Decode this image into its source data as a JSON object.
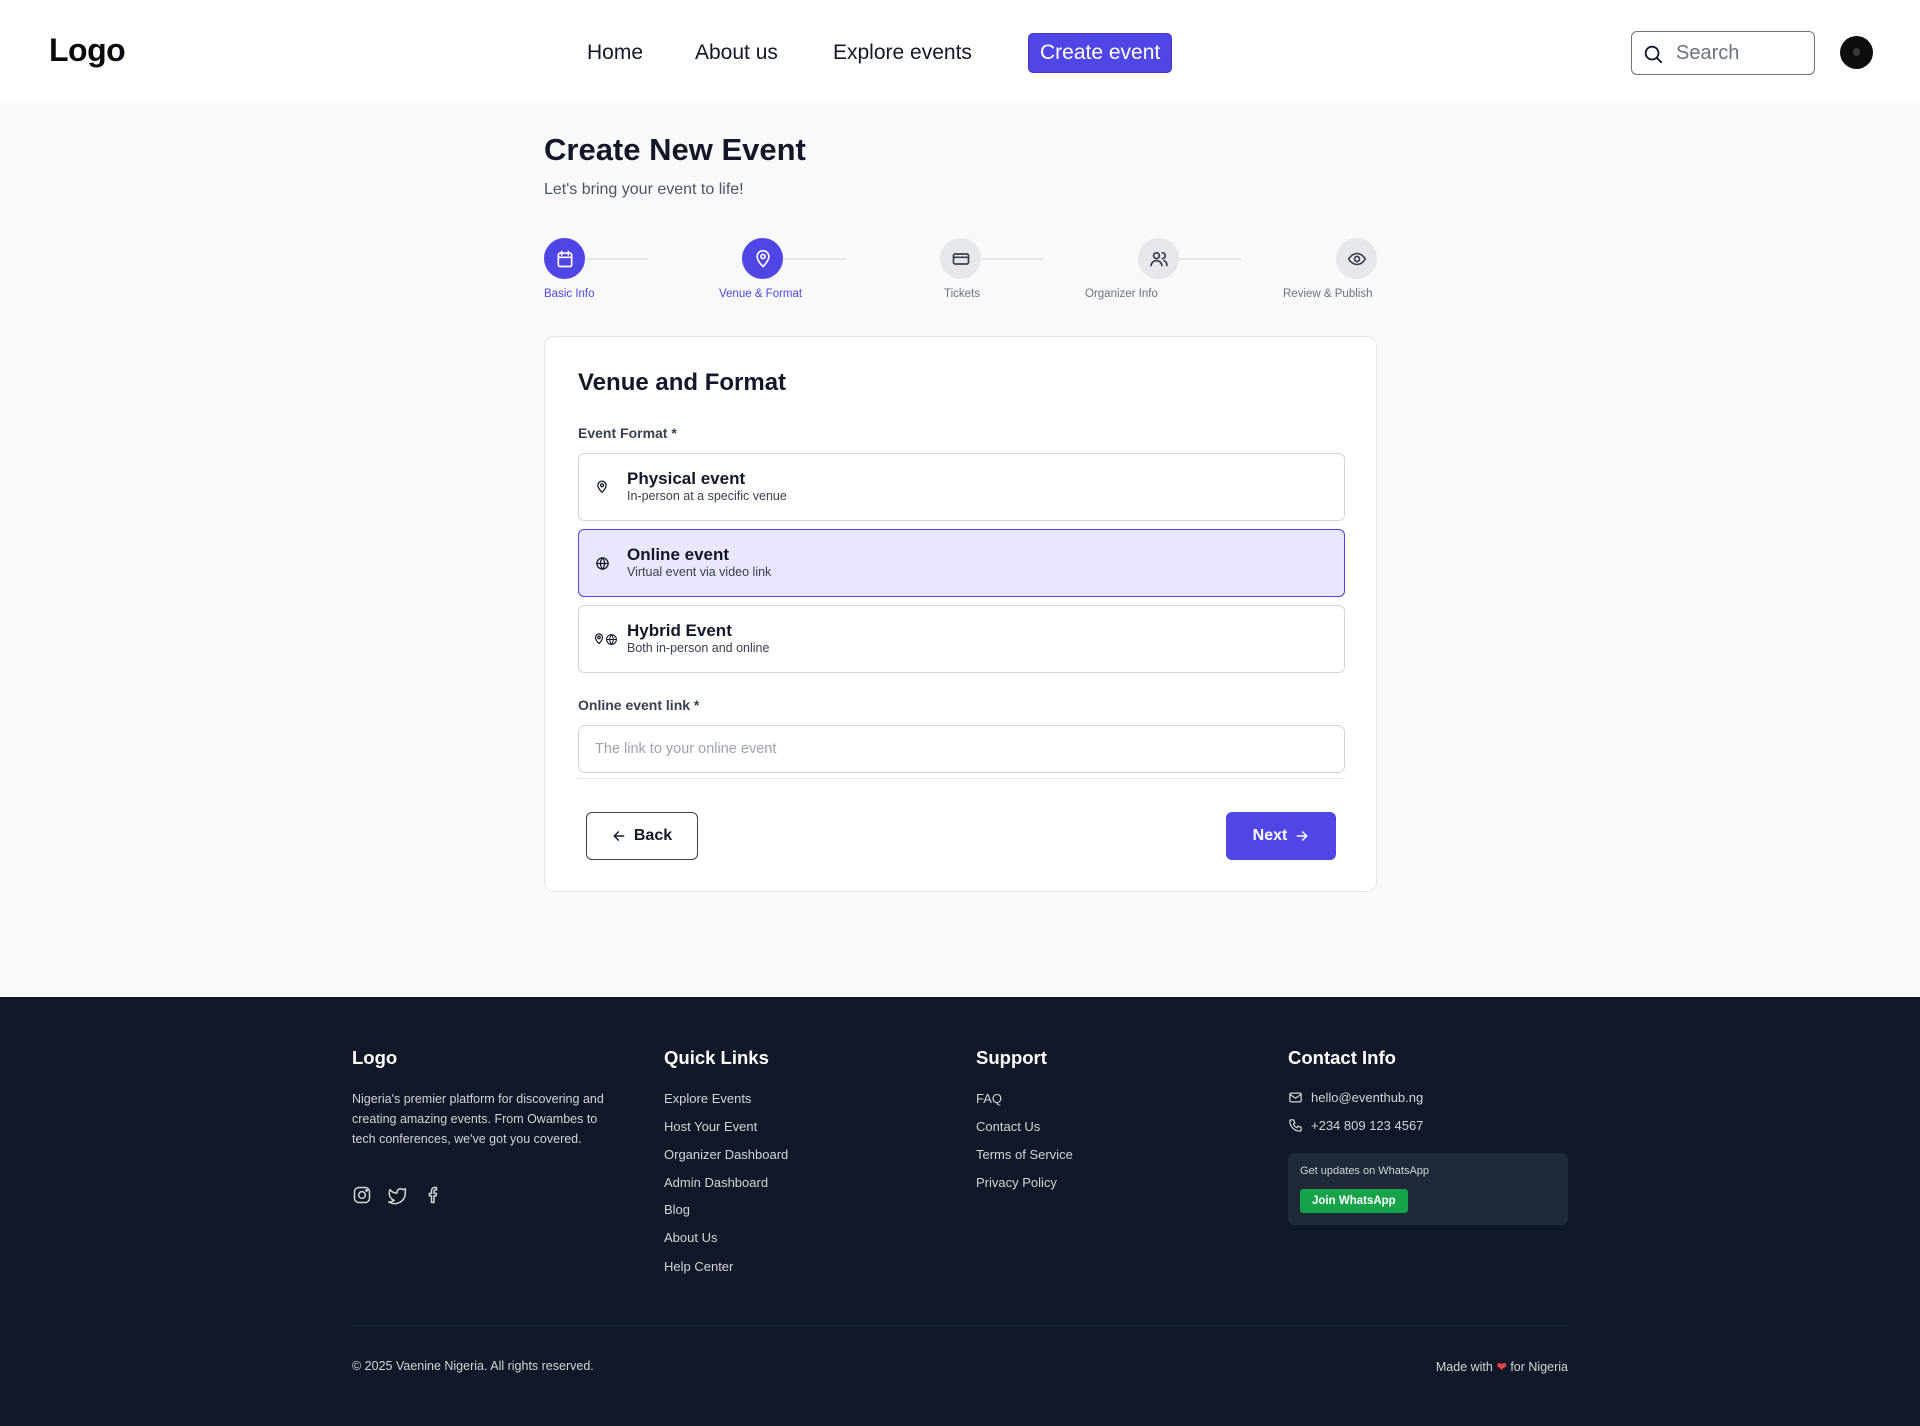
{
  "header": {
    "logo": "Logo",
    "nav": [
      "Home",
      "About us",
      "Explore events"
    ],
    "cta": "Create event",
    "search_placeholder": "Search"
  },
  "page": {
    "title": "Create New Event",
    "subtitle": "Let's bring your event to life!"
  },
  "steps": [
    {
      "label": "Basic Info",
      "icon": "calendar-icon",
      "active": true
    },
    {
      "label": "Venue & Format",
      "icon": "map-pin-icon",
      "active": true
    },
    {
      "label": "Tickets",
      "icon": "ticket-icon",
      "active": false
    },
    {
      "label": "Organizer Info",
      "icon": "users-icon",
      "active": false
    },
    {
      "label": "Review & Publish",
      "icon": "eye-icon",
      "active": false
    }
  ],
  "form": {
    "title": "Venue and Format",
    "format_label": "Event Format *",
    "options": [
      {
        "title": "Physical event",
        "desc": "In-person at a specific venue",
        "icon": "map-pin-icon",
        "selected": false
      },
      {
        "title": "Online event",
        "desc": "Virtual event via video link",
        "icon": "globe-icon",
        "selected": true
      },
      {
        "title": "Hybrid Event",
        "desc": "Both in-person and online",
        "icon": "pin-globe-icon",
        "selected": false
      }
    ],
    "link_label": "Online event link *",
    "link_placeholder": "The link to your online event",
    "link_value": "",
    "back_label": "Back",
    "next_label": "Next"
  },
  "footer": {
    "brand": "Logo",
    "description": "Nigeria's premier platform for discovering and creating amazing events. From Owambes to tech conferences, we've got you covered.",
    "quick_links_title": "Quick Links",
    "quick_links": [
      "Explore Events",
      "Host Your Event",
      "Organizer Dashboard",
      "Admin Dashboard",
      "Blog",
      "About Us",
      "Help Center"
    ],
    "support_title": "Support",
    "support_links": [
      "FAQ",
      "Contact Us",
      "Terms of Service",
      "Privacy Policy"
    ],
    "contact_title": "Contact Info",
    "email": "hello@eventhub.ng",
    "phone": "+234 809 123 4567",
    "whatsapp_text": "Get updates on WhatsApp",
    "whatsapp_button": "Join WhatsApp",
    "copyright": "© 2025 Vaenine Nigeria. All rights reserved.",
    "made_prefix": "Made with",
    "made_suffix": "for Nigeria"
  },
  "colors": {
    "accent": "#4f46e5",
    "selected_bg": "#e9e7fd",
    "footer_bg": "#111827",
    "whatsapp": "#16a34a"
  }
}
